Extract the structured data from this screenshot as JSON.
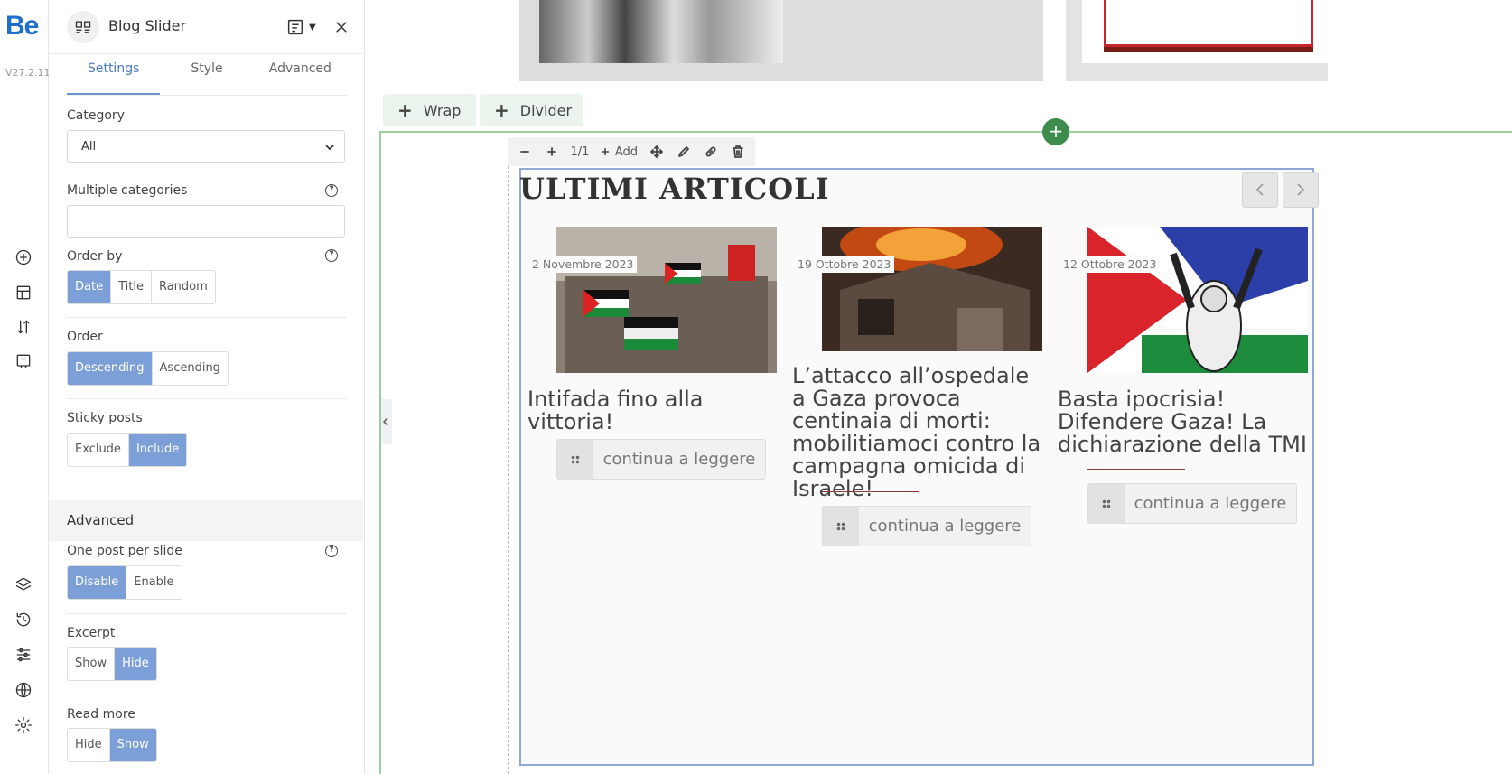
{
  "app": {
    "logo": "Be",
    "version": "V27.2.11"
  },
  "rail": {
    "icons": [
      "add-element-icon",
      "layout-icon",
      "sort-icon",
      "template-icon",
      "layers-icon",
      "history-icon",
      "sliders-icon",
      "globe-icon",
      "settings-icon"
    ]
  },
  "panel": {
    "title": "Blog Slider",
    "tabs": [
      {
        "label": "Settings",
        "active": true
      },
      {
        "label": "Style",
        "active": false
      },
      {
        "label": "Advanced",
        "active": false
      }
    ],
    "category": {
      "label": "Category",
      "value": "All"
    },
    "multiple_categories": {
      "label": "Multiple categories",
      "value": ""
    },
    "order_by": {
      "label": "Order by",
      "options": [
        "Date",
        "Title",
        "Random"
      ],
      "selected": "Date"
    },
    "order": {
      "label": "Order",
      "options": [
        "Descending",
        "Ascending"
      ],
      "selected": "Descending"
    },
    "sticky": {
      "label": "Sticky posts",
      "options": [
        "Exclude",
        "Include"
      ],
      "selected": "Include"
    },
    "advanced_heading": "Advanced",
    "one_post": {
      "label": "One post per slide",
      "options": [
        "Disable",
        "Enable"
      ],
      "selected": "Disable"
    },
    "excerpt": {
      "label": "Excerpt",
      "options": [
        "Show",
        "Hide"
      ],
      "selected": "Hide"
    },
    "read_more": {
      "label": "Read more",
      "options": [
        "Hide",
        "Show"
      ],
      "selected": "Show"
    }
  },
  "canvas": {
    "add_wrap": "Wrap",
    "add_divider": "Divider",
    "item_bar": {
      "size": "1/1",
      "add": "Add"
    },
    "slider_title": "ULTIMI ARTICOLI",
    "posts": [
      {
        "date": "2 Novembre 2023",
        "title": "Intifada fino alla vittoria!",
        "read_more": "continua a leggere"
      },
      {
        "date": "19 Ottobre 2023",
        "title": "L’attacco all’ospedale a Gaza provoca centinaia di morti: mobilitiamoci contro la campagna omicida di Israele!",
        "read_more": "continua a leggere"
      },
      {
        "date": "12 Ottobre 2023",
        "title": "Basta ipocrisia! Difendere Gaza! La dichiarazione della TMI",
        "read_more": "continua a leggere"
      }
    ]
  }
}
